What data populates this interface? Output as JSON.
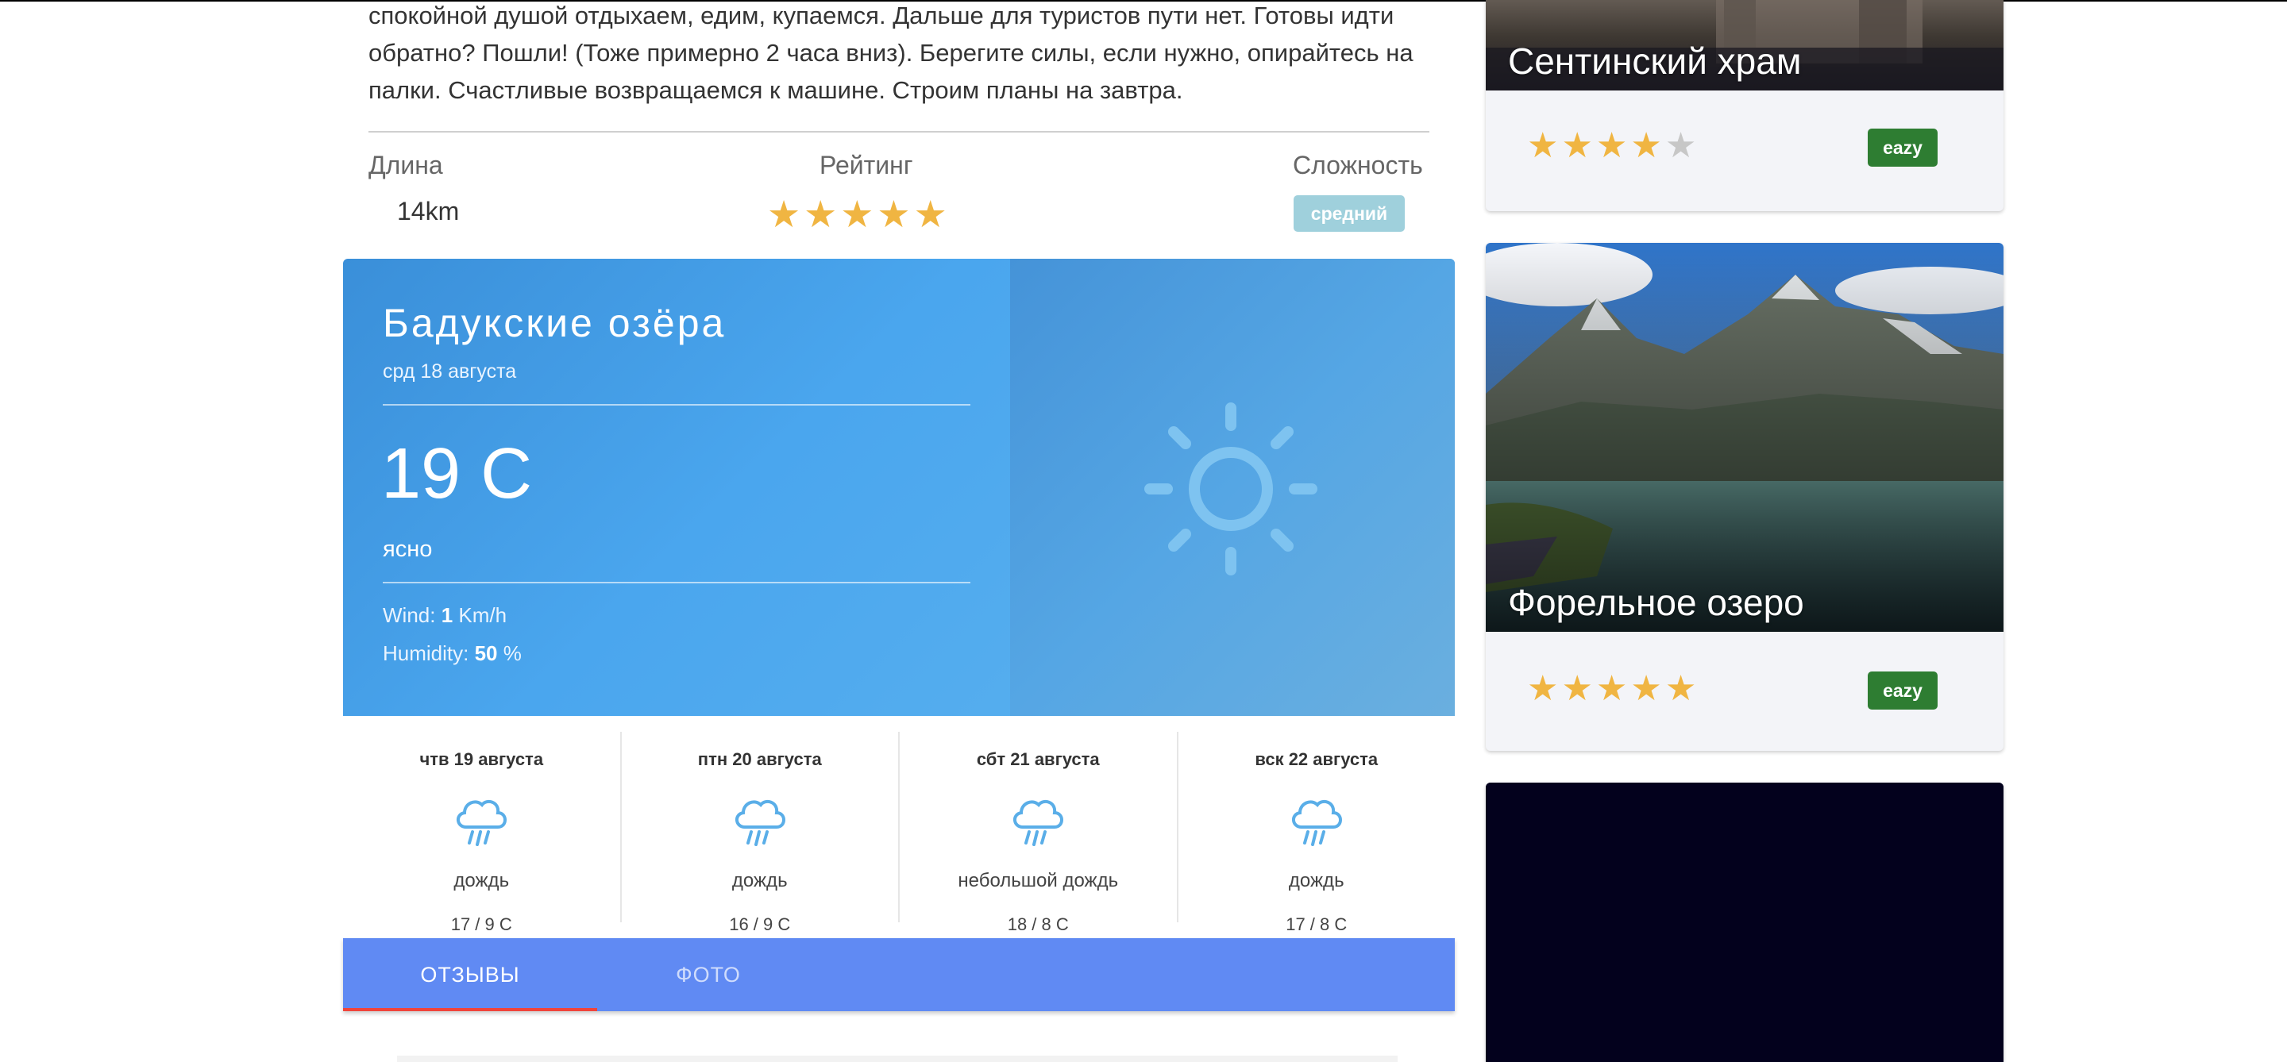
{
  "article": {
    "text": "спокойной душой отдыхаем, едим, купаемся. Дальше для туристов пути нет. Готовы идти обратно? Пошли! (Тоже примерно 2 часа вниз). Берегите силы, если нужно, опирайтесь на палки. Счастливые возвращаемся к машине. Строим планы на завтра."
  },
  "meta": {
    "length_label": "Длина",
    "length_value": "14km",
    "rating_label": "Рейтинг",
    "rating_stars": 5,
    "difficulty_label": "Сложность",
    "difficulty_value": "средний"
  },
  "weather": {
    "city": "Бадукские озёра",
    "date": "срд 18 августа",
    "temp": "19 C",
    "desc": "ясно",
    "wind_label": "Wind:",
    "wind_value": "1",
    "wind_unit": "Km/h",
    "humidity_label": "Humidity:",
    "humidity_value": "50",
    "humidity_unit": "%",
    "icon": "sun-icon",
    "forecast": [
      {
        "date": "чтв 19 августа",
        "desc": "дождь",
        "temps": "17 / 9 C",
        "icon": "rain-cloud-icon"
      },
      {
        "date": "птн 20 августа",
        "desc": "дождь",
        "temps": "16 / 9 C",
        "icon": "rain-cloud-icon"
      },
      {
        "date": "сбт 21 августа",
        "desc": "небольшой дождь",
        "temps": "18 / 8 C",
        "icon": "rain-cloud-icon"
      },
      {
        "date": "вск 22 августа",
        "desc": "дождь",
        "temps": "17 / 8 C",
        "icon": "rain-cloud-icon"
      }
    ]
  },
  "tabs": [
    {
      "label": "ОТЗЫВЫ",
      "active": true
    },
    {
      "label": "ФОТО",
      "active": false
    }
  ],
  "sidebar": {
    "cards": [
      {
        "title": "Сентинский храм",
        "rating": 4,
        "difficulty": "eazy"
      },
      {
        "title": "Форельное озеро",
        "rating": 5,
        "difficulty": "eazy"
      },
      {
        "title": "",
        "rating": null,
        "difficulty": ""
      }
    ]
  },
  "colors": {
    "star": "#f0b542",
    "tab_bar": "#608af3",
    "tab_indicator": "#f0443a",
    "badge_easy": "#2e7d32",
    "badge_medium": "#9fd0dc"
  }
}
